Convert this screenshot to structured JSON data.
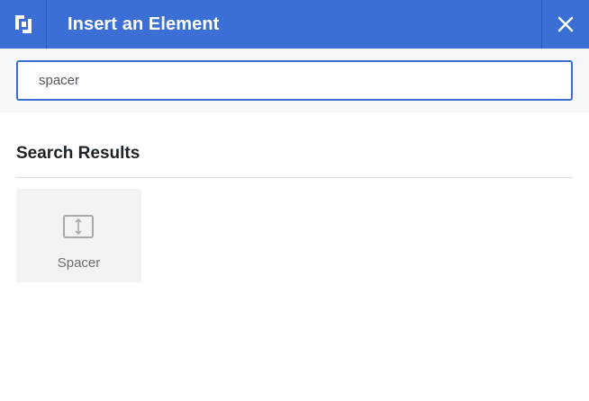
{
  "header": {
    "title": "Insert an Element",
    "background_color": "#3b6fd6",
    "logo_icon": "builder-logo-icon",
    "close_icon": "close-icon"
  },
  "search": {
    "value": "spacer",
    "border_color": "#3b6fd6"
  },
  "results": {
    "heading": "Search Results",
    "items": [
      {
        "label": "Spacer",
        "icon": "spacer-icon"
      }
    ]
  }
}
